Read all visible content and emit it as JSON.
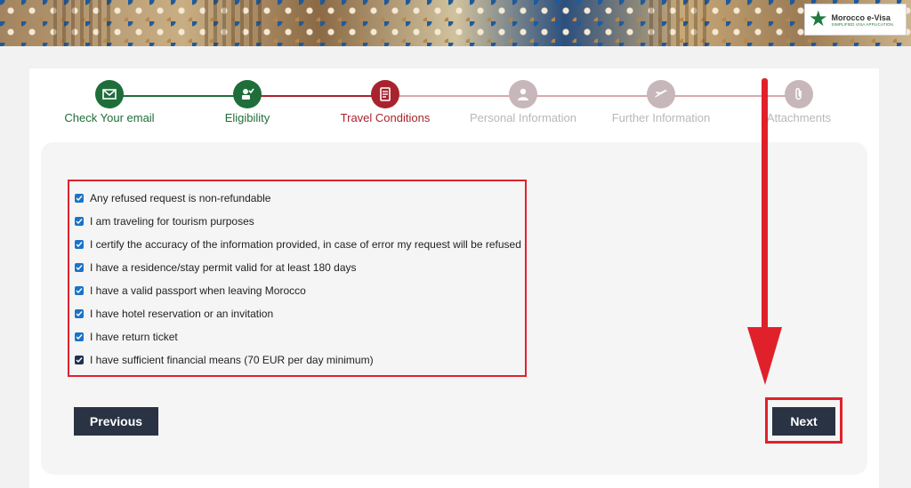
{
  "brand": {
    "title": "Morocco e-Visa",
    "subtitle": "SIMPLIFIED VISA APPLICATION",
    "accent": "#1f7a3f"
  },
  "steps": [
    {
      "label": "Check Your email",
      "icon": "envelope-icon",
      "state": "done",
      "color": "#1f6e3a"
    },
    {
      "label": "Eligibility",
      "icon": "eligibility-icon",
      "state": "done",
      "color": "#1f6e3a"
    },
    {
      "label": "Travel Conditions",
      "icon": "document-icon",
      "state": "active",
      "color": "#a8232e"
    },
    {
      "label": "Personal Information",
      "icon": "person-icon",
      "state": "pending",
      "color": "#c7b7ba"
    },
    {
      "label": "Further Information",
      "icon": "plane-icon",
      "state": "pending",
      "color": "#c7b7ba"
    },
    {
      "label": "Attachments",
      "icon": "paperclip-icon",
      "state": "pending",
      "color": "#c7b7ba"
    }
  ],
  "conditions": [
    {
      "text": "Any refused request is non-refundable",
      "checked": true
    },
    {
      "text": "I am traveling for tourism purposes",
      "checked": true
    },
    {
      "text": "I certify the accuracy of the information provided, in case of error my request will be refused",
      "checked": true
    },
    {
      "text": "I have a residence/stay permit valid for at least 180 days",
      "checked": true
    },
    {
      "text": "I have a valid passport when leaving Morocco",
      "checked": true
    },
    {
      "text": "I have hotel reservation or an invitation",
      "checked": true
    },
    {
      "text": "I have return ticket",
      "checked": true
    },
    {
      "text": "I have sufficient financial means (70 EUR per day minimum)",
      "checked": true
    }
  ],
  "buttons": {
    "previous": "Previous",
    "next": "Next"
  },
  "colors": {
    "highlight": "#e0212c",
    "button": "#2a3344",
    "checkbox": "#1a73c9"
  }
}
